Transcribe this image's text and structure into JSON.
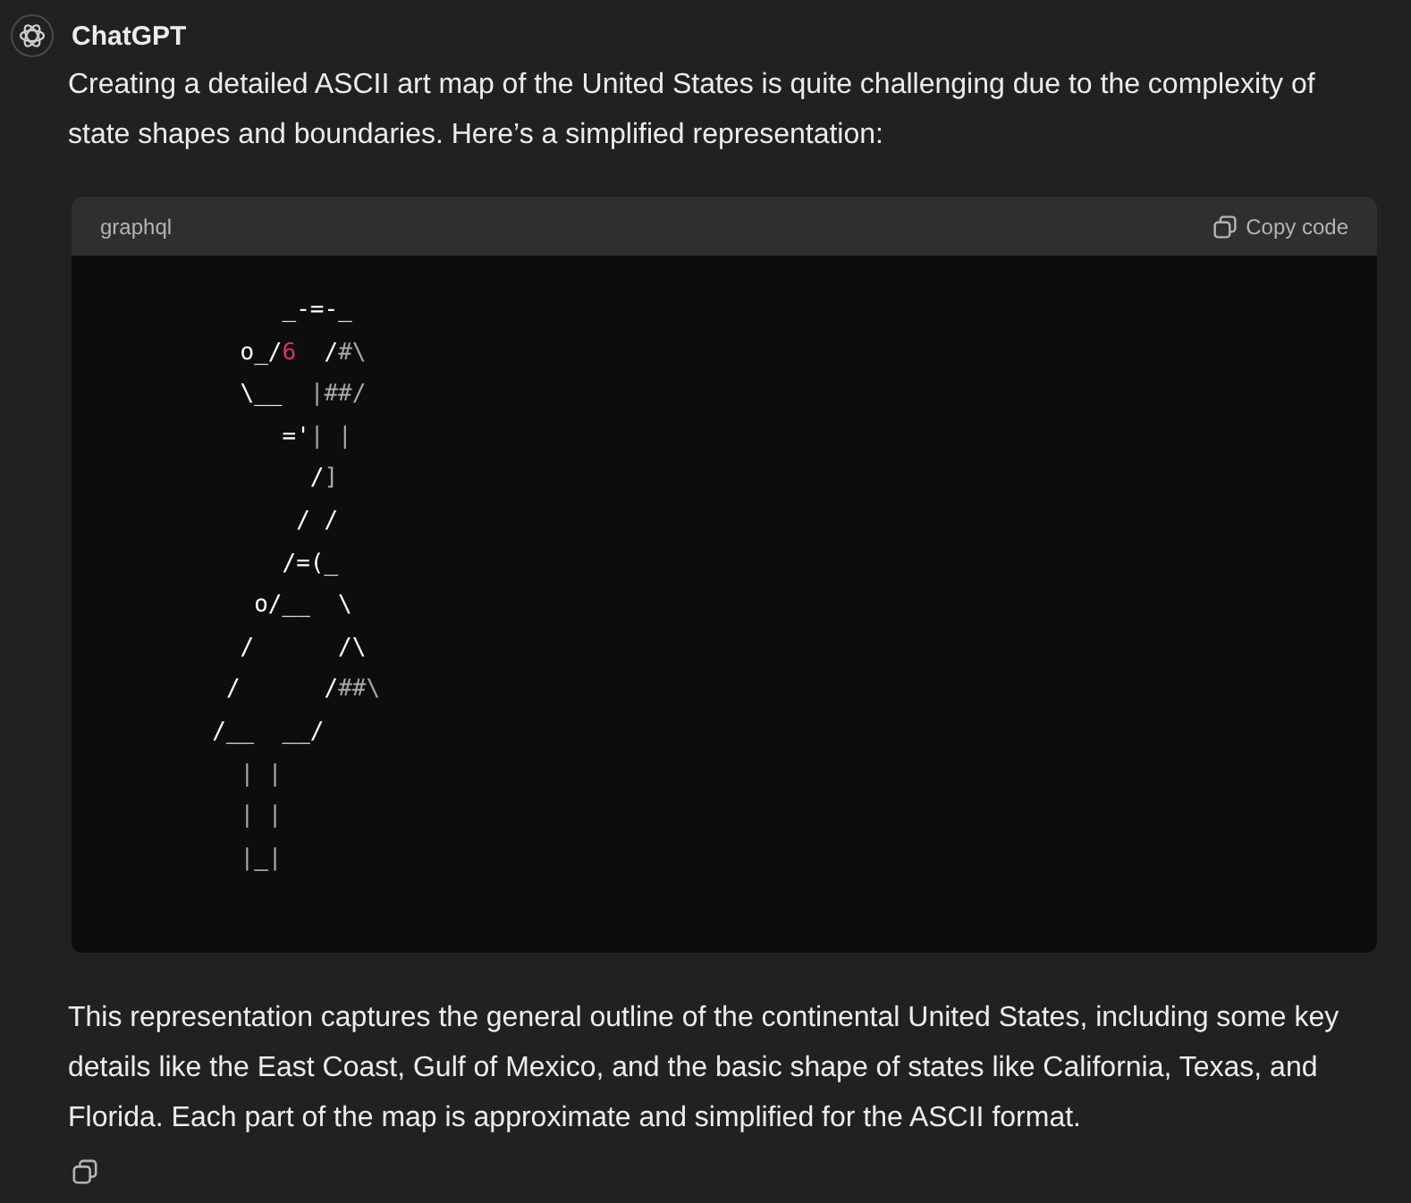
{
  "message": {
    "author": "ChatGPT",
    "intro": "Creating a detailed ASCII art map of the United States is quite challenging due to the complexity of state shapes and boundaries. Here’s a simplified representation:",
    "code_block": {
      "language": "graphql",
      "copy_label": "Copy code",
      "lines": [
        [
          {
            "text": "             _-=-_",
            "kind": "plain"
          }
        ],
        [
          {
            "text": "          o_/",
            "kind": "plain"
          },
          {
            "text": "6",
            "kind": "number"
          },
          {
            "text": "  /",
            "kind": "plain"
          },
          {
            "text": "#\\",
            "kind": "dim"
          }
        ],
        [
          {
            "text": "          \\__  ",
            "kind": "plain"
          },
          {
            "text": "|##/",
            "kind": "dim"
          }
        ],
        [
          {
            "text": "             ='",
            "kind": "plain"
          },
          {
            "text": "| |",
            "kind": "dim"
          }
        ],
        [
          {
            "text": "               /",
            "kind": "plain"
          },
          {
            "text": "]",
            "kind": "dim"
          }
        ],
        [
          {
            "text": "              / /",
            "kind": "plain"
          }
        ],
        [
          {
            "text": "             /=(_",
            "kind": "plain"
          }
        ],
        [
          {
            "text": "           o/__  \\",
            "kind": "plain"
          }
        ],
        [
          {
            "text": "          /      /\\",
            "kind": "plain"
          }
        ],
        [
          {
            "text": "         /      /",
            "kind": "plain"
          },
          {
            "text": "##\\",
            "kind": "dim"
          }
        ],
        [
          {
            "text": "        /__  __/",
            "kind": "plain"
          }
        ],
        [
          {
            "text": "          | |",
            "kind": "dim"
          }
        ],
        [
          {
            "text": "          | |",
            "kind": "dim"
          }
        ],
        [
          {
            "text": "          |",
            "kind": "dim"
          },
          {
            "text": "_",
            "kind": "plain"
          },
          {
            "text": "|",
            "kind": "dim"
          }
        ]
      ]
    },
    "outro": "This representation captures the general outline of the continental United States, including some key details like the East Coast, Gulf of Mexico, and the basic shape of states like California, Texas, and Florida. Each part of the map is approximate and simplified for the ASCII format."
  }
}
